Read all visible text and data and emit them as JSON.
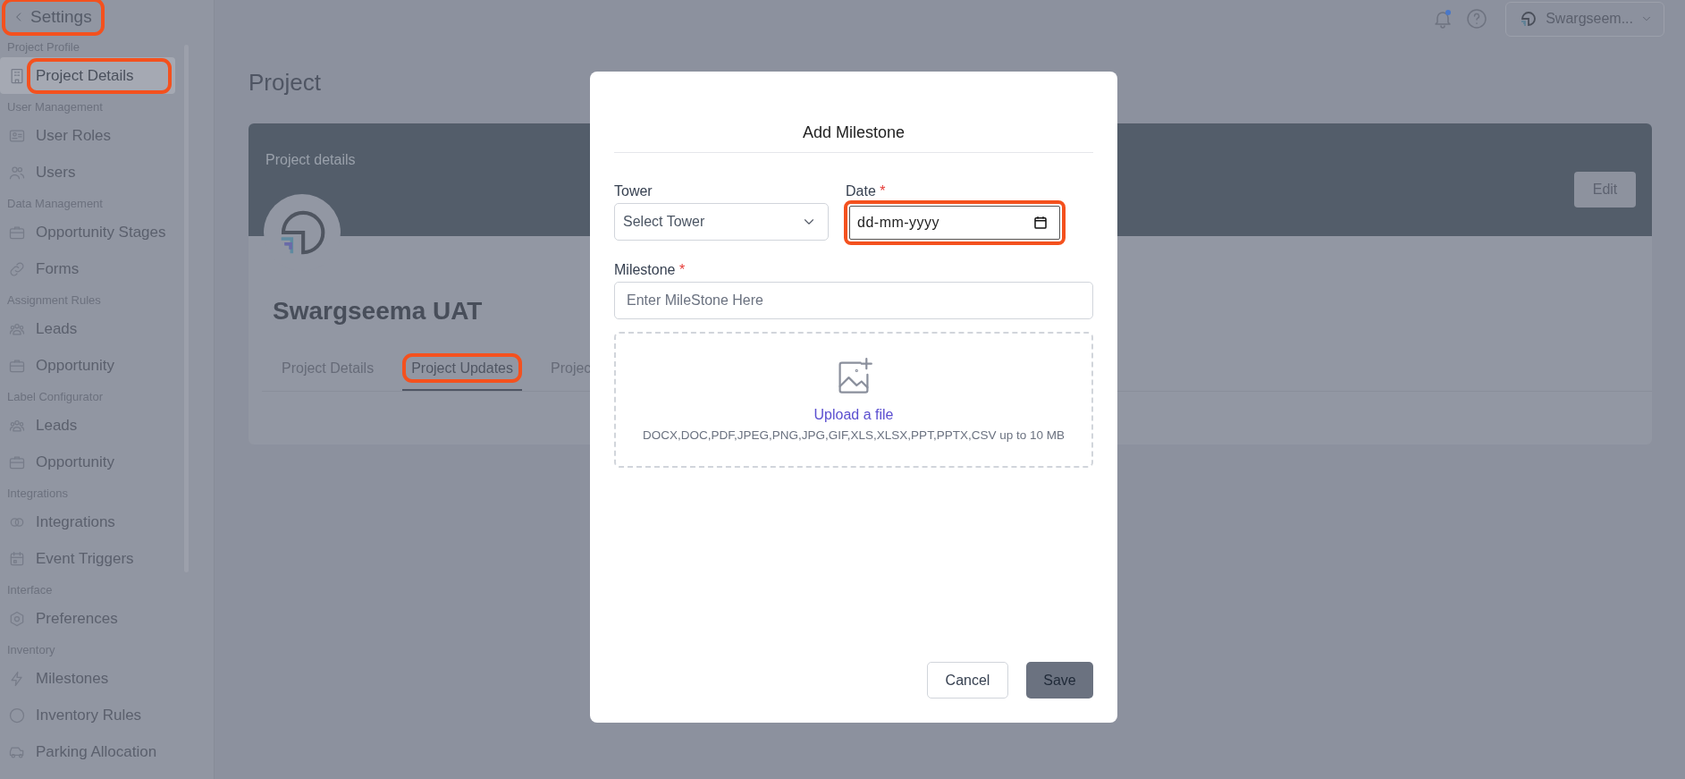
{
  "header": {
    "back_label": "Settings",
    "highlighted": true
  },
  "top_bar": {
    "account_name": "Swargseem..."
  },
  "sidebar": {
    "sections": [
      {
        "title": "Project Profile",
        "items": [
          {
            "label": "Project Details",
            "selected": true,
            "highlighted": true
          }
        ]
      },
      {
        "title": "User Management",
        "items": [
          {
            "label": "User Roles",
            "selected": false,
            "highlighted": false
          },
          {
            "label": "Users",
            "selected": false,
            "highlighted": false
          }
        ]
      },
      {
        "title": "Data Management",
        "items": [
          {
            "label": "Opportunity Stages",
            "selected": false,
            "highlighted": false
          },
          {
            "label": "Forms",
            "selected": false,
            "highlighted": false
          }
        ]
      },
      {
        "title": "Assignment Rules",
        "items": [
          {
            "label": "Leads",
            "selected": false,
            "highlighted": false
          },
          {
            "label": "Opportunity",
            "selected": false,
            "highlighted": false
          }
        ]
      },
      {
        "title": "Label Configurator",
        "items": [
          {
            "label": "Leads",
            "selected": false,
            "highlighted": false
          },
          {
            "label": "Opportunity",
            "selected": false,
            "highlighted": false
          }
        ]
      },
      {
        "title": "Integrations",
        "items": [
          {
            "label": "Integrations",
            "selected": false,
            "highlighted": false
          },
          {
            "label": "Event Triggers",
            "selected": false,
            "highlighted": false
          }
        ]
      },
      {
        "title": "Interface",
        "items": [
          {
            "label": "Preferences",
            "selected": false,
            "highlighted": false
          }
        ]
      },
      {
        "title": "Inventory",
        "items": [
          {
            "label": "Milestones",
            "selected": false,
            "highlighted": false
          },
          {
            "label": "Inventory Rules",
            "selected": false,
            "highlighted": false
          },
          {
            "label": "Parking Allocation",
            "selected": false,
            "highlighted": false
          }
        ]
      }
    ]
  },
  "page": {
    "title": "Project",
    "card": {
      "header_label": "Project details",
      "edit_button": "Edit",
      "project_name": "Swargseema UAT",
      "tabs": [
        {
          "label": "Project Details",
          "selected": false,
          "highlighted": false
        },
        {
          "label": "Project Updates",
          "selected": true,
          "highlighted": true
        },
        {
          "label": "Projec",
          "selected": false,
          "highlighted": false
        }
      ]
    }
  },
  "dialog": {
    "title": "Add Milestone",
    "fields": [
      {
        "kind": "select",
        "label": "Tower",
        "placeholder": "Select Tower",
        "highlighted": false
      },
      {
        "kind": "date",
        "label": "Date",
        "mark": "*",
        "placeholder": "dd-mm-yyyy",
        "highlighted": true
      },
      {
        "kind": "text",
        "label": "Milestone",
        "mark": "*",
        "placeholder": "Enter MileStone Here",
        "highlighted": false
      }
    ],
    "upload": {
      "link": "Upload a file",
      "hint": "DOCX,DOC,PDF,JPEG,PNG,JPG,GIF,XLS,XLSX,PPT,PPTX,CSV up to 10 MB"
    },
    "buttons": [
      {
        "label": "Cancel",
        "kind": "secondary"
      },
      {
        "label": "Save",
        "kind": "primary"
      }
    ]
  }
}
